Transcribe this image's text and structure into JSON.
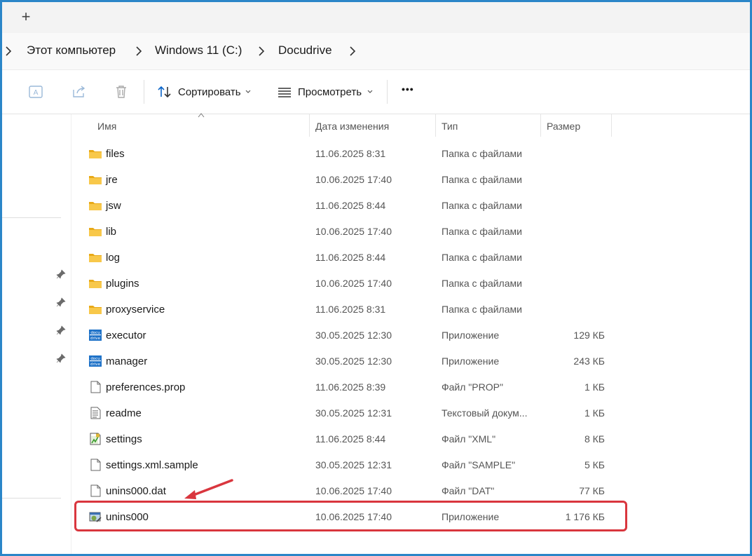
{
  "titlebar": {
    "new_tab_symbol": "+"
  },
  "breadcrumb": [
    "Этот компьютер",
    "Windows 11 (C:)",
    "Docudrive"
  ],
  "toolbar": {
    "sort_label": "Сортировать",
    "view_label": "Просмотреть",
    "more_symbol": "•••"
  },
  "columns": {
    "name": "Имя",
    "date": "Дата изменения",
    "type": "Тип",
    "size": "Размер"
  },
  "files": [
    {
      "icon": "folder-icon",
      "name": "files",
      "date": "11.06.2025 8:31",
      "type": "Папка с файлами",
      "size": ""
    },
    {
      "icon": "folder-icon",
      "name": "jre",
      "date": "10.06.2025 17:40",
      "type": "Папка с файлами",
      "size": ""
    },
    {
      "icon": "folder-icon",
      "name": "jsw",
      "date": "11.06.2025 8:44",
      "type": "Папка с файлами",
      "size": ""
    },
    {
      "icon": "folder-icon",
      "name": "lib",
      "date": "10.06.2025 17:40",
      "type": "Папка с файлами",
      "size": ""
    },
    {
      "icon": "folder-icon",
      "name": "log",
      "date": "11.06.2025 8:44",
      "type": "Папка с файлами",
      "size": ""
    },
    {
      "icon": "folder-icon",
      "name": "plugins",
      "date": "10.06.2025 17:40",
      "type": "Папка с файлами",
      "size": ""
    },
    {
      "icon": "folder-icon",
      "name": "proxyservice",
      "date": "11.06.2025 8:31",
      "type": "Папка с файлами",
      "size": ""
    },
    {
      "icon": "docudrive-app-icon",
      "name": "executor",
      "date": "30.05.2025 12:30",
      "type": "Приложение",
      "size": "129 КБ"
    },
    {
      "icon": "docudrive-app-icon",
      "name": "manager",
      "date": "30.05.2025 12:30",
      "type": "Приложение",
      "size": "243 КБ"
    },
    {
      "icon": "file-icon",
      "name": "preferences.prop",
      "date": "11.06.2025 8:39",
      "type": "Файл \"PROP\"",
      "size": "1 КБ"
    },
    {
      "icon": "text-file-icon",
      "name": "readme",
      "date": "30.05.2025 12:31",
      "type": "Текстовый докум...",
      "size": "1 КБ"
    },
    {
      "icon": "xml-file-icon",
      "name": "settings",
      "date": "11.06.2025 8:44",
      "type": "Файл \"XML\"",
      "size": "8 КБ"
    },
    {
      "icon": "file-icon",
      "name": "settings.xml.sample",
      "date": "30.05.2025 12:31",
      "type": "Файл \"SAMPLE\"",
      "size": "5 КБ"
    },
    {
      "icon": "file-icon",
      "name": "unins000.dat",
      "date": "10.06.2025 17:40",
      "type": "Файл \"DAT\"",
      "size": "77 КБ"
    },
    {
      "icon": "installer-app-icon",
      "name": "unins000",
      "date": "10.06.2025 17:40",
      "type": "Приложение",
      "size": "1 176 КБ"
    }
  ],
  "annotation": {
    "highlight_color": "#d9363e",
    "highlighted_file": "unins000"
  },
  "colors": {
    "window_border": "#2b86c8",
    "folder": "#f6c342",
    "accent": "#0a64c8"
  }
}
